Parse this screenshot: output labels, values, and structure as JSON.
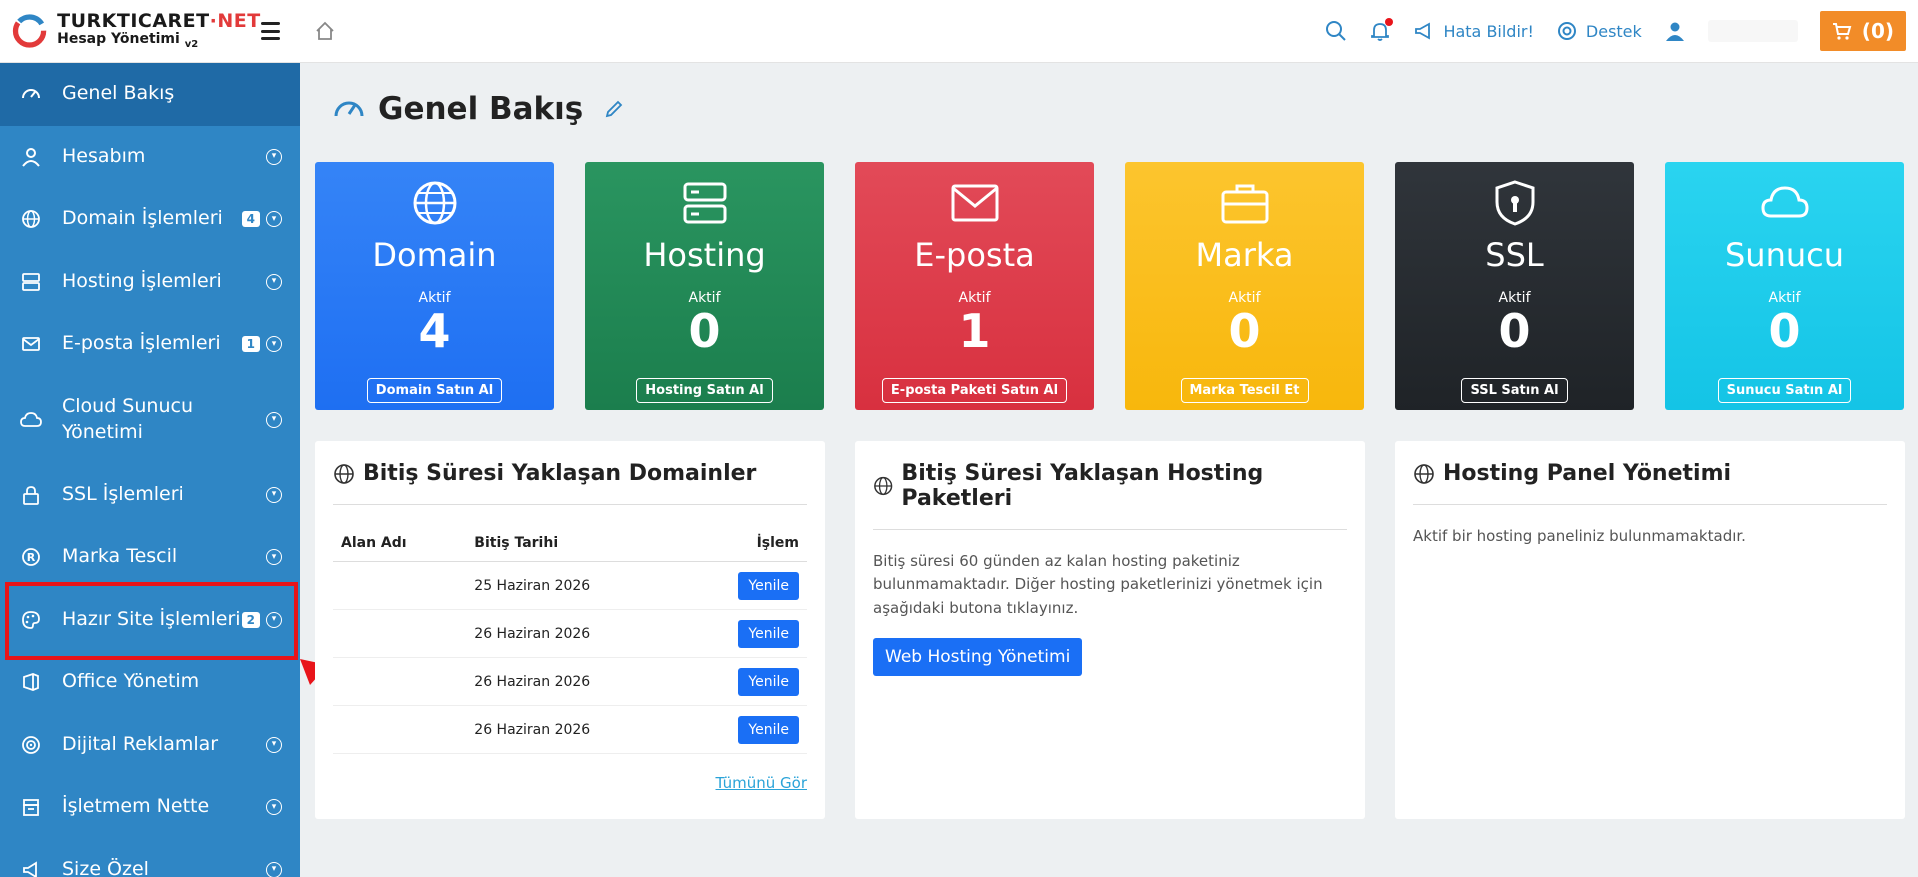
{
  "brand": {
    "name_main": "TURKTICARET",
    "name_dot": "·",
    "name_tld": "NET",
    "subtitle": "Hesap Yönetimi",
    "version": "v2"
  },
  "sidebar": {
    "items": [
      {
        "label": "Genel Bakış",
        "icon": "dashboard-icon",
        "active": true
      },
      {
        "label": "Hesabım",
        "icon": "user-icon",
        "chevron": true
      },
      {
        "label": "Domain İşlemleri",
        "icon": "globe-icon",
        "badge": "4",
        "chevron": true
      },
      {
        "label": "Hosting İşlemleri",
        "icon": "server-icon",
        "chevron": true
      },
      {
        "label": "E-posta İşlemleri",
        "icon": "mail-icon",
        "badge": "1",
        "chevron": true
      },
      {
        "label": "Cloud Sunucu Yönetimi",
        "icon": "cloud-icon",
        "chevron": true
      },
      {
        "label": "SSL İşlemleri",
        "icon": "lock-icon",
        "chevron": true
      },
      {
        "label": "Marka Tescil",
        "icon": "registered-icon",
        "chevron": true
      },
      {
        "label": "Hazır Site İşlemleri",
        "icon": "palette-icon",
        "badge": "2",
        "chevron": true
      },
      {
        "label": "Office Yönetim",
        "icon": "office-icon"
      },
      {
        "label": "Dijital Reklamlar",
        "icon": "target-icon",
        "chevron": true
      },
      {
        "label": "İşletmem Nette",
        "icon": "store-icon",
        "chevron": true
      },
      {
        "label": "Size Özel",
        "icon": "megaphone-icon",
        "chevron": true
      }
    ]
  },
  "topbar": {
    "report_bug": "Hata Bildir!",
    "support": "Destek",
    "cart": "(0)"
  },
  "page": {
    "title": "Genel Bakış"
  },
  "cards": [
    {
      "title": "Domain",
      "sub": "Aktif",
      "count": "4",
      "button": "Domain Satın Al",
      "color": "#2f7bf5",
      "icon": "globe-icon"
    },
    {
      "title": "Hosting",
      "sub": "Aktif",
      "count": "0",
      "button": "Hosting Satın Al",
      "color": "#208a55",
      "icon": "server-icon"
    },
    {
      "title": "E-posta",
      "sub": "Aktif",
      "count": "1",
      "button": "E-posta Paketi Satın Al",
      "color": "#dc3545",
      "icon": "mail-icon"
    },
    {
      "title": "Marka",
      "sub": "Aktif",
      "count": "0",
      "button": "Marka Tescil Et",
      "color": "#fbbf1a",
      "icon": "briefcase-icon"
    },
    {
      "title": "SSL",
      "sub": "Aktif",
      "count": "0",
      "button": "SSL Satın Al",
      "color": "#262a2f",
      "icon": "shield-lock-icon"
    },
    {
      "title": "Sunucu",
      "sub": "Aktif",
      "count": "0",
      "button": "Sunucu Satın Al",
      "color": "#1dcbeb",
      "icon": "cloud-icon"
    }
  ],
  "domains_panel": {
    "title": "Bitiş Süresi Yaklaşan Domainler",
    "columns": [
      "Alan Adı",
      "Bitiş Tarihi",
      "İşlem"
    ],
    "rows": [
      {
        "domain": "",
        "date": "25 Haziran 2026",
        "action": "Yenile"
      },
      {
        "domain": "",
        "date": "26 Haziran 2026",
        "action": "Yenile"
      },
      {
        "domain": "",
        "date": "26 Haziran 2026",
        "action": "Yenile"
      },
      {
        "domain": "",
        "date": "26 Haziran 2026",
        "action": "Yenile"
      }
    ],
    "see_all": "Tümünü Gör"
  },
  "hosting_panel": {
    "title": "Bitiş Süresi Yaklaşan Hosting Paketleri",
    "text": "Bitiş süresi 60 günden az kalan hosting paketiniz bulunmamaktadır. Diğer hosting paketlerinizi yönetmek için aşağıdaki butona tıklayınız.",
    "button": "Web Hosting Yönetimi"
  },
  "panel_mgmt": {
    "title": "Hosting Panel Yönetimi",
    "text": "Aktif bir hosting paneliniz bulunmamaktadır."
  }
}
